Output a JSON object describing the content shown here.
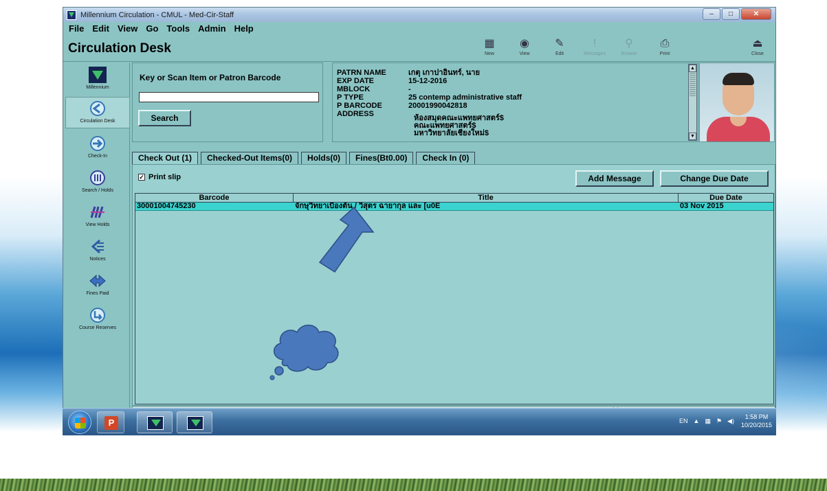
{
  "window": {
    "title": "Millennium Circulation - CMUL - Med-Cir-Staff",
    "controls": {
      "minimize": "–",
      "maximize": "□",
      "close": "✕"
    }
  },
  "menu": [
    {
      "label": "File"
    },
    {
      "label": "Edit"
    },
    {
      "label": "View"
    },
    {
      "label": "Go"
    },
    {
      "label": "Tools"
    },
    {
      "label": "Admin"
    },
    {
      "label": "Help"
    }
  ],
  "toolbar": {
    "heading": "Circulation Desk",
    "buttons": [
      {
        "label": "New",
        "icon": "new-icon"
      },
      {
        "label": "View",
        "icon": "view-icon"
      },
      {
        "label": "Edit",
        "icon": "edit-icon"
      },
      {
        "label": "Messages",
        "icon": "messages-icon"
      },
      {
        "label": "Browse",
        "icon": "browse-icon"
      },
      {
        "label": "Print",
        "icon": "print-icon"
      },
      {
        "label": "Close",
        "icon": "close-icon"
      }
    ]
  },
  "sidebar": {
    "items": [
      {
        "label": "Millennium"
      },
      {
        "label": "Circulation Desk"
      },
      {
        "label": "Check-In"
      },
      {
        "label": "Search / Holds"
      },
      {
        "label": "View Holds"
      },
      {
        "label": "Notices"
      },
      {
        "label": "Fines Paid"
      },
      {
        "label": "Course Reserves"
      }
    ]
  },
  "scan": {
    "label": "Key or Scan Item or Patron Barcode",
    "value": "",
    "search_button": "Search"
  },
  "patron": {
    "fields": [
      {
        "key": "PATRN NAME",
        "value": "เกตุ เกาปาอินทร์, นาย"
      },
      {
        "key": "EXP DATE",
        "value": "15-12-2016"
      },
      {
        "key": "MBLOCK",
        "value": "-"
      },
      {
        "key": "P TYPE",
        "value": "25 contemp administrative staff"
      },
      {
        "key": "P BARCODE",
        "value": "20001990042818"
      },
      {
        "key": "ADDRESS",
        "value": ""
      }
    ],
    "address_lines": [
      "ห้องสมุดคณะแพทยศาสตร์$",
      "คณะแพทยศาสตร์$",
      "มหาวิทยาลัยเชียงใหม่$"
    ]
  },
  "tabs": [
    {
      "label": "Check Out (1)",
      "active": true
    },
    {
      "label": "Checked-Out Items(0)",
      "active": false
    },
    {
      "label": "Holds(0)",
      "active": false
    },
    {
      "label": "Fines(Bt0.00)",
      "active": false
    },
    {
      "label": "Check In (0)",
      "active": false
    }
  ],
  "checkout": {
    "print_slip_label": "Print slip",
    "print_slip_checked": true,
    "add_message_button": "Add Message",
    "change_due_date_button": "Change Due Date",
    "columns": [
      "Barcode",
      "Title",
      "Due Date"
    ],
    "rows": [
      {
        "barcode": "30001004745230",
        "title": "จักษุวิทยาเบื้องต้น / วิสุตร ฉายากุล และ [u0E",
        "due_date": "03 Nov 2015"
      }
    ]
  },
  "taskbar": {
    "language": "EN",
    "time": "1:58 PM",
    "date": "10/20/2015"
  },
  "colors": {
    "window_bg": "#8cc4c4",
    "selected_row": "#3bd3cf",
    "annotation_fill": "#4a78bd"
  }
}
